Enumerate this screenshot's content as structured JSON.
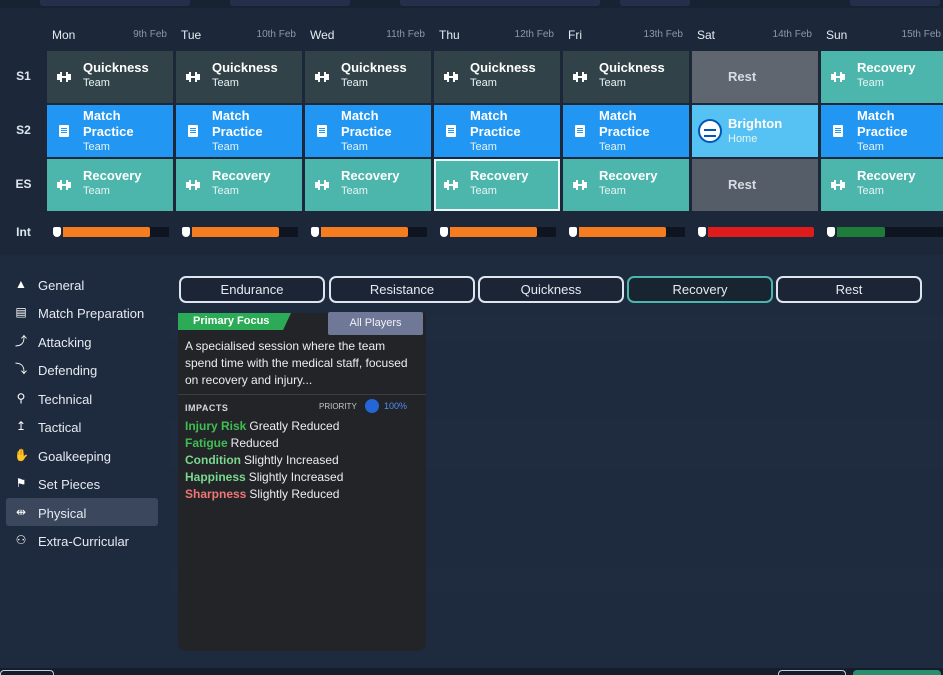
{
  "days": [
    {
      "name": "Mon",
      "date": "9th Feb"
    },
    {
      "name": "Tue",
      "date": "10th Feb"
    },
    {
      "name": "Wed",
      "date": "11th Feb"
    },
    {
      "name": "Thu",
      "date": "12th Feb"
    },
    {
      "name": "Fri",
      "date": "13th Feb"
    },
    {
      "name": "Sat",
      "date": "14th Feb"
    },
    {
      "name": "Sun",
      "date": "15th Feb"
    }
  ],
  "rows": {
    "s1": "S1",
    "s2": "S2",
    "es": "ES",
    "int": "Int"
  },
  "sessions": {
    "s1": [
      {
        "title": "Quickness",
        "sub": "Team",
        "icon": "dumbbell-icon"
      },
      {
        "title": "Quickness",
        "sub": "Team",
        "icon": "dumbbell-icon"
      },
      {
        "title": "Quickness",
        "sub": "Team",
        "icon": "dumbbell-icon"
      },
      {
        "title": "Quickness",
        "sub": "Team",
        "icon": "dumbbell-icon"
      },
      {
        "title": "Quickness",
        "sub": "Team",
        "icon": "dumbbell-icon"
      },
      {
        "title": "Rest",
        "sub": ""
      },
      {
        "title": "Recovery",
        "sub": "Team",
        "icon": "dumbbell-icon"
      }
    ],
    "s2": [
      {
        "title": "Match Practice",
        "sub": "Team",
        "icon": "match-practice-icon"
      },
      {
        "title": "Match Practice",
        "sub": "Team",
        "icon": "match-practice-icon"
      },
      {
        "title": "Match Practice",
        "sub": "Team",
        "icon": "match-practice-icon"
      },
      {
        "title": "Match Practice",
        "sub": "Team",
        "icon": "match-practice-icon"
      },
      {
        "title": "Match Practice",
        "sub": "Team",
        "icon": "match-practice-icon"
      },
      {
        "title": "Brighton",
        "sub": "Home",
        "icon": "club-badge-icon"
      },
      {
        "title": "Match Practice",
        "sub": "Team",
        "icon": "match-practice-icon"
      }
    ],
    "es": [
      {
        "title": "Recovery",
        "sub": "Team",
        "icon": "dumbbell-icon"
      },
      {
        "title": "Recovery",
        "sub": "Team",
        "icon": "dumbbell-icon"
      },
      {
        "title": "Recovery",
        "sub": "Team",
        "icon": "dumbbell-icon"
      },
      {
        "title": "Recovery",
        "sub": "Team",
        "icon": "dumbbell-icon"
      },
      {
        "title": "Recovery",
        "sub": "Team",
        "icon": "dumbbell-icon"
      },
      {
        "title": "Rest",
        "sub": ""
      },
      {
        "title": "Recovery",
        "sub": "Team",
        "icon": "dumbbell-icon"
      }
    ]
  },
  "intensity": [
    {
      "level": 0.82,
      "color": "#f57c1f"
    },
    {
      "level": 0.82,
      "color": "#f57c1f"
    },
    {
      "level": 0.82,
      "color": "#f57c1f"
    },
    {
      "level": 0.82,
      "color": "#f57c1f"
    },
    {
      "level": 0.82,
      "color": "#f57c1f"
    },
    {
      "level": 1.0,
      "color": "#e01b1b"
    },
    {
      "level": 0.45,
      "color": "#1e7b3a"
    }
  ],
  "sidebar": [
    {
      "label": "General",
      "icon": "general-icon"
    },
    {
      "label": "Match Preparation",
      "icon": "match-preparation-icon"
    },
    {
      "label": "Attacking",
      "icon": "attacking-icon"
    },
    {
      "label": "Defending",
      "icon": "defending-icon"
    },
    {
      "label": "Technical",
      "icon": "technical-icon"
    },
    {
      "label": "Tactical",
      "icon": "tactical-icon"
    },
    {
      "label": "Goalkeeping",
      "icon": "goalkeeping-icon"
    },
    {
      "label": "Set Pieces",
      "icon": "set-pieces-icon"
    },
    {
      "label": "Physical",
      "icon": "dumbbell-icon"
    },
    {
      "label": "Extra-Curricular",
      "icon": "extra-curricular-icon"
    }
  ],
  "tabs": [
    "Endurance",
    "Resistance",
    "Quickness",
    "Recovery",
    "Rest"
  ],
  "detail": {
    "primary_focus": "Primary Focus",
    "players_button": "All Players",
    "description": "A specialised session where the team spend time with the medical staff, focused on recovery and injury...",
    "impacts_label": "IMPACTS",
    "priority_label": "PRIORITY",
    "priority_value": "100%",
    "impacts": [
      {
        "key": "Injury Risk",
        "value": "Greatly Reduced",
        "color": "#3fbf53"
      },
      {
        "key": "Fatigue",
        "value": "Reduced",
        "color": "#3fbf53"
      },
      {
        "key": "Condition",
        "value": "Slightly Increased",
        "color": "#7ad88e"
      },
      {
        "key": "Happiness",
        "value": "Slightly Increased",
        "color": "#7ad88e"
      },
      {
        "key": "Sharpness",
        "value": "Slightly Reduced",
        "color": "#f07575"
      }
    ]
  }
}
